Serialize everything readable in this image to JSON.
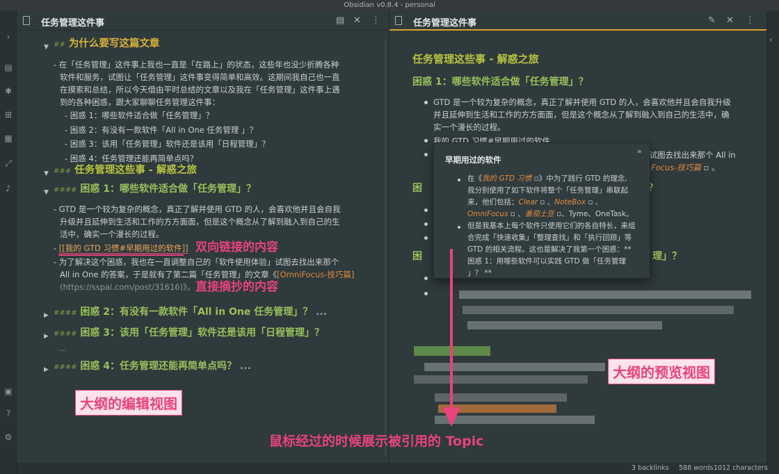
{
  "window": {
    "title": "Obsidian v0.8.4 - personal"
  },
  "left_pane": {
    "title": "任务管理这件事",
    "h2": "为什么要写这篇文章",
    "h2_md": "##",
    "intro": [
      "- 在「任务管理」这件事上我也一直是「在路上」的状态，这些年也没少折腾各种",
      "软件和服务，试图让「任务管理」这件事变得简单和高效。这期间我自己也一直",
      "在摸索和总结，所以今天借由平时总结的文章以及我在「任务管理」这件事上遇",
      "到的各种困惑，跟大家聊聊任务管理这件事："
    ],
    "sub_items": [
      "- 困惑 1：哪些软件适合做「任务管理」？",
      "- 困惑 2：有没有一款软件「All in One 任务管理 」？",
      "- 困惑 3：该用「任务管理」软件还是该用「日程管理」？",
      "- 困惑 4：任务管理还能再简单点吗？"
    ],
    "h3": "任务管理这些事 - 解惑之旅",
    "h3_md": "###",
    "h4_1": "困惑 1：哪些软件适合做「任务管理」？",
    "h4_md": "####",
    "p1": [
      "- GTD 是一个较为复杂的概念，真正了解并使用 GTD 的人，会喜欢他并且会自我",
      "升级并且延伸到生活和工作的方方面面，但是这个概念从了解到融入到自己的生",
      "活中，确实一个漫长的过程。"
    ],
    "wiki_prefix": "- ",
    "wiki": "[[我的 GTD 习惯#早期用过的软件]]",
    "p2_line1": "- 为了解决这个困惑，我也在一直调整自己的「软件使用体验」试图去找出来那个",
    "p2_line2a": "All in One 的答案，于是就有了第二篇「任务管理」的文章《",
    "p2_link": "[OmniFocus-技巧篇]",
    "p2_line3": "(https://sspai.com/post/31616)》。",
    "h4_2": "困惑 2：有没有一款软件「All in One 任务管理」？",
    "h4_3": "困惑 3：该用「任务管理」软件还是该用「日程管理」？",
    "h4_4": "困惑 4：任务管理还能再简单点吗？",
    "ellipsis": "..."
  },
  "right_pane": {
    "title": "任务管理这件事",
    "h3": "任务管理这些事 - 解惑之旅",
    "h4_1": "困惑 1：哪些软件适合做「任务管理」？",
    "p1": [
      "GTD 是一个较为复杂的概念，真正了解并使用 GTD 的人，会喜欢他并且会自我升级",
      "并且延伸到生活和工作的方方面面，但是这个概念从了解到融入到自己的生活中，确",
      "实一个漫长的过程。"
    ],
    "wiki": "我的 GTD 习惯#早期用过的软件",
    "p2a": "为了解决这个困惑，我也在一直调整自己的「软件使用体验」试图去找出来那个 All in",
    "p2b": "Focus-技巧篇",
    "h4_2_frag": "困",
    "h4_3_frag": "困",
    "q_end": "？",
    "h4_3_end": "理」？"
  },
  "popup": {
    "title": "早期用过的软件",
    "b1_l1a": "在《",
    "b1_link": "我的 GTD 习惯",
    "b1_l1b": "》中为了践行 GTD 的理念,",
    "b1_l2": "我分别使用了如下软件将整个「任务管理」串联起",
    "b1_l3a": "来，他们包括：",
    "b1_clear": "Clear",
    "b1_sep1": " 、",
    "b1_notebox": "NoteBox",
    "b1_sep2": " 、",
    "b1_omni": "OmniFocus",
    "b1_sep3": " 、",
    "b1_tudou": "番茄土豆",
    "b1_rest": "、Tyme、OneTask。",
    "b2_l1": "但是我基本上每个软件只使用它们的各自特长，来组",
    "b2_l2": "合完成「快速收集」「整理查找」和「执行回顾」等",
    "b2_l3": "GTD 的相关流程。这也是解决了我第一个困惑：**",
    "b2_l4": "困惑 1：用哪些软件可以实践 GTD 做「任务管理",
    "b2_l5": "」？ **"
  },
  "annotations": {
    "wiki_label": "双向链接的内容",
    "copy_label": "直接摘抄的内容",
    "edit_view": "大纲的编辑视图",
    "preview_view": "大纲的预览视图",
    "hover_note": "鼠标经过的时候展示被引用的 Topic"
  },
  "status": {
    "backlinks": "3 backlinks",
    "words": "588 words",
    "characters": "1012 characters"
  },
  "colors": {
    "background": "#2f3a3d",
    "h2": "#d8b33a",
    "h3": "#b9c43f",
    "h4": "#98c05a",
    "link": "#e08a3a",
    "accent_active": "#e0a028",
    "annotation": "#e8437a"
  }
}
